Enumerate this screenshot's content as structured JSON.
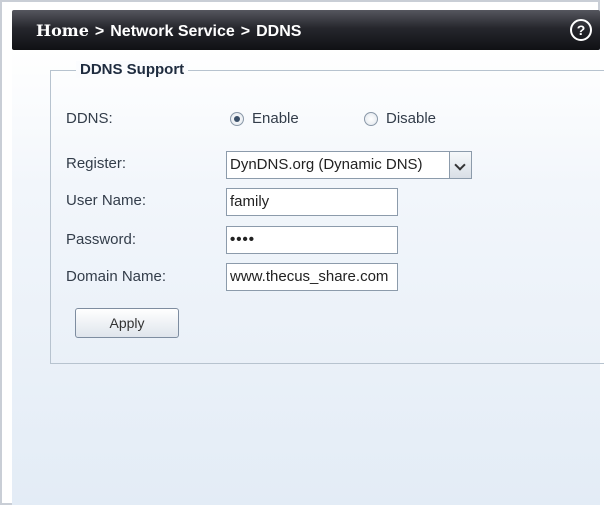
{
  "breadcrumb": {
    "home": "Home",
    "separator": ">",
    "section": "Network Service",
    "page": "DDNS"
  },
  "help_icon": "question-circle-icon",
  "ddns_support": {
    "title": "DDNS Support",
    "ddns": {
      "label": "DDNS:",
      "options": [
        "Enable",
        "Disable"
      ],
      "selected": "Enable"
    },
    "register": {
      "label": "Register:",
      "value": "DynDNS.org (Dynamic DNS)"
    },
    "user_name": {
      "label": "User Name:",
      "value": "family"
    },
    "password": {
      "label": "Password:",
      "value": "••••"
    },
    "domain_name": {
      "label": "Domain Name:",
      "value": "www.thecus_share.com"
    },
    "apply_label": "Apply"
  },
  "colors": {
    "titlebar": "#1c1d22",
    "content_bg": "#e9f0f8",
    "label_text": "#333d4a"
  }
}
